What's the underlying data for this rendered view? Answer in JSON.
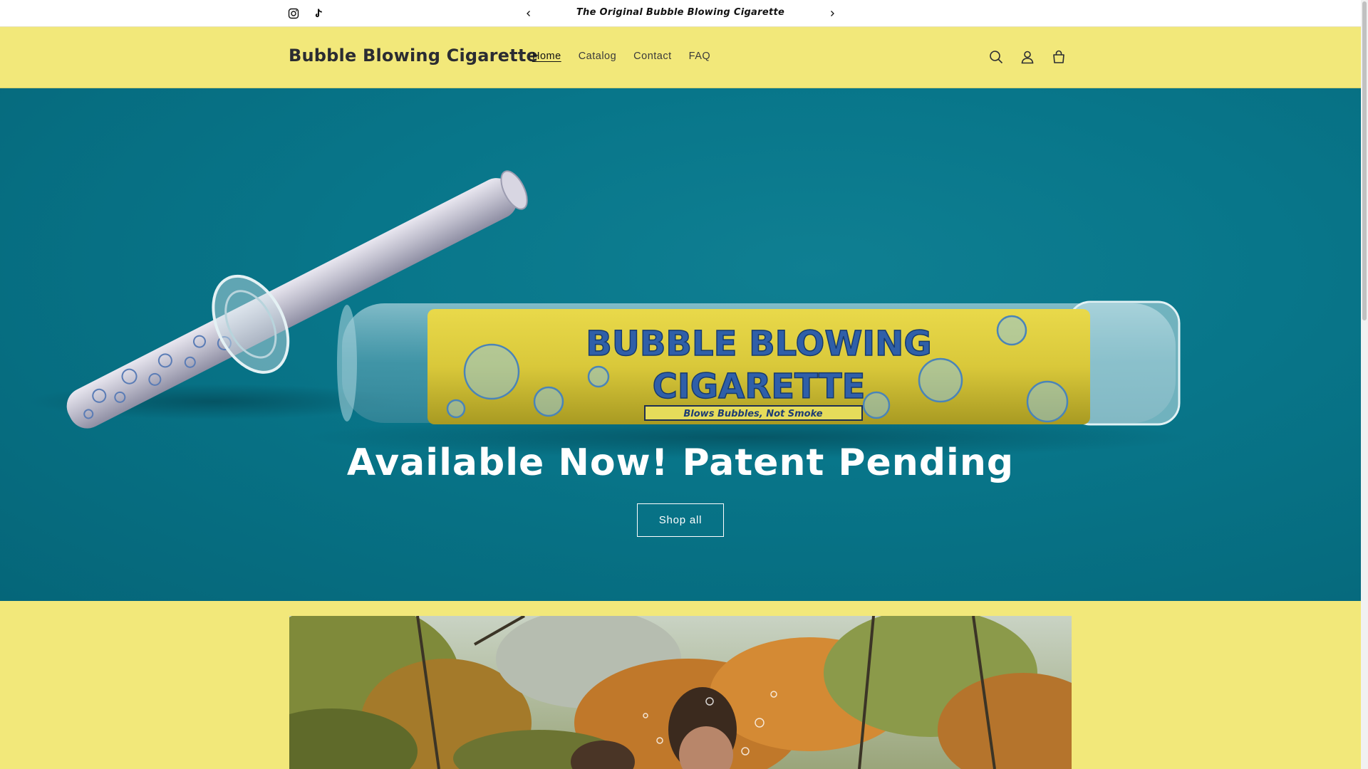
{
  "announcement": {
    "social": [
      {
        "name": "instagram-icon"
      },
      {
        "name": "tiktok-icon"
      }
    ],
    "prev_icon": "chevron-left-icon",
    "next_icon": "chevron-right-icon",
    "text": "The Original Bubble Blowing Cigarette"
  },
  "header": {
    "logo": "Bubble Blowing Cigarette",
    "nav": [
      {
        "label": "Home",
        "active": true
      },
      {
        "label": "Catalog",
        "active": false
      },
      {
        "label": "Contact",
        "active": false
      },
      {
        "label": "FAQ",
        "active": false
      }
    ],
    "icons": [
      "search-icon",
      "account-icon",
      "cart-icon"
    ]
  },
  "hero": {
    "title": "Available Now! Patent Pending",
    "button_label": "Shop all",
    "package_text_1": "BUBBLE BLOWING",
    "package_text_2": "CIGARETTE",
    "package_tagline": "Blows Bubbles, Not Smoke"
  },
  "colors": {
    "accent_yellow": "#f2e87a",
    "hero_teal": "#08768a",
    "text_dark": "#121212",
    "package_blue": "#2f5fa8"
  }
}
